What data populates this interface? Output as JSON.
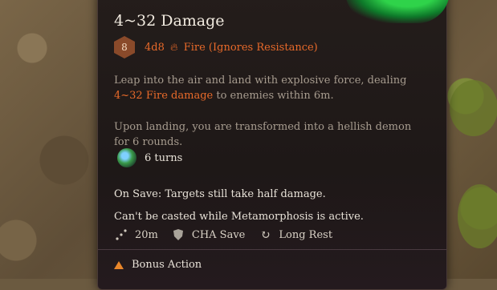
{
  "tooltip": {
    "title": "4~32 Damage",
    "die_value": "8",
    "dice_expr": "4d8",
    "damage_text": "Fire (Ignores Resistance)",
    "desc_a_pre": "Leap into the air and land with explosive force, dealing",
    "desc_a_highlight": "4~32 Fire damage",
    "desc_a_post": "to enemies within 6m.",
    "desc_b": "Upon landing, you are transformed into a hellish demon for 6 rounds.",
    "duration": "6 turns",
    "on_save": "On Save: Targets still take half damage.",
    "restriction": "Can't be casted while Metamorphosis is active.",
    "range": "20m",
    "save": "CHA Save",
    "recharge": "Long Rest",
    "action_type": "Bonus Action"
  },
  "colors": {
    "damage": "#e86a2a",
    "bonus_action": "#e8862a"
  },
  "icons": {
    "die": "d8-die-icon",
    "flame": "flame-icon",
    "duration": "demon-form-icon",
    "range": "range-icon",
    "save": "shield-save-icon",
    "recharge": "long-rest-icon",
    "action": "bonus-action-triangle-icon"
  }
}
